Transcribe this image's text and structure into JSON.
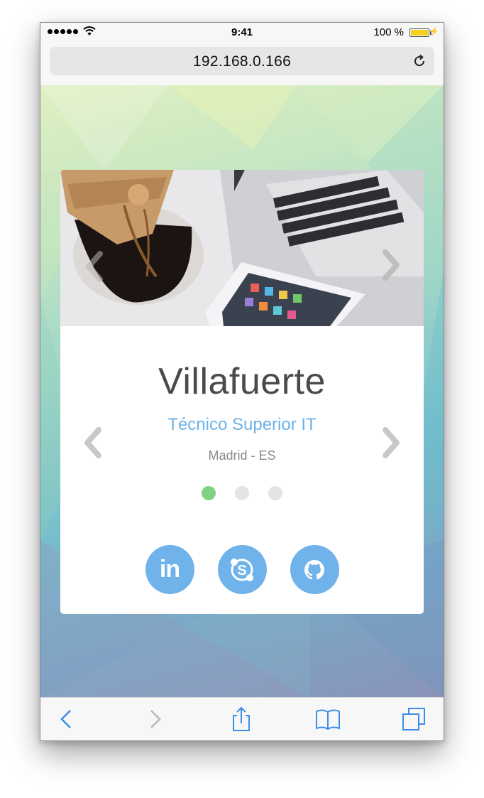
{
  "status_bar": {
    "time": "9:41",
    "battery_percent": "100 %",
    "battery_level": 1.0,
    "signal_icon": "signal-dots-icon",
    "wifi_icon": "wifi-icon",
    "battery_icon": "battery-icon",
    "charging_icon": "bolt-icon"
  },
  "url_bar": {
    "url": "192.168.0.166",
    "reload_icon": "reload-icon"
  },
  "card": {
    "name": "Villafuerte",
    "role": "Técnico Superior IT",
    "location": "Madrid - ES",
    "slide_count": 3,
    "active_slide": 1,
    "social": [
      {
        "name": "linkedin",
        "label": "in"
      },
      {
        "name": "skype",
        "label": "S"
      },
      {
        "name": "github",
        "label": ""
      }
    ]
  },
  "toolbar": {
    "items": [
      "back-icon",
      "forward-icon",
      "share-icon",
      "bookmarks-icon",
      "tabs-icon"
    ]
  },
  "colors": {
    "accent": "#6fb3ea",
    "active_dot": "#7fd184",
    "name_text": "#4a4a4a",
    "role_text": "#6cb2e8",
    "battery": "#f8d11a",
    "ios_blue": "#3a8ee6"
  }
}
